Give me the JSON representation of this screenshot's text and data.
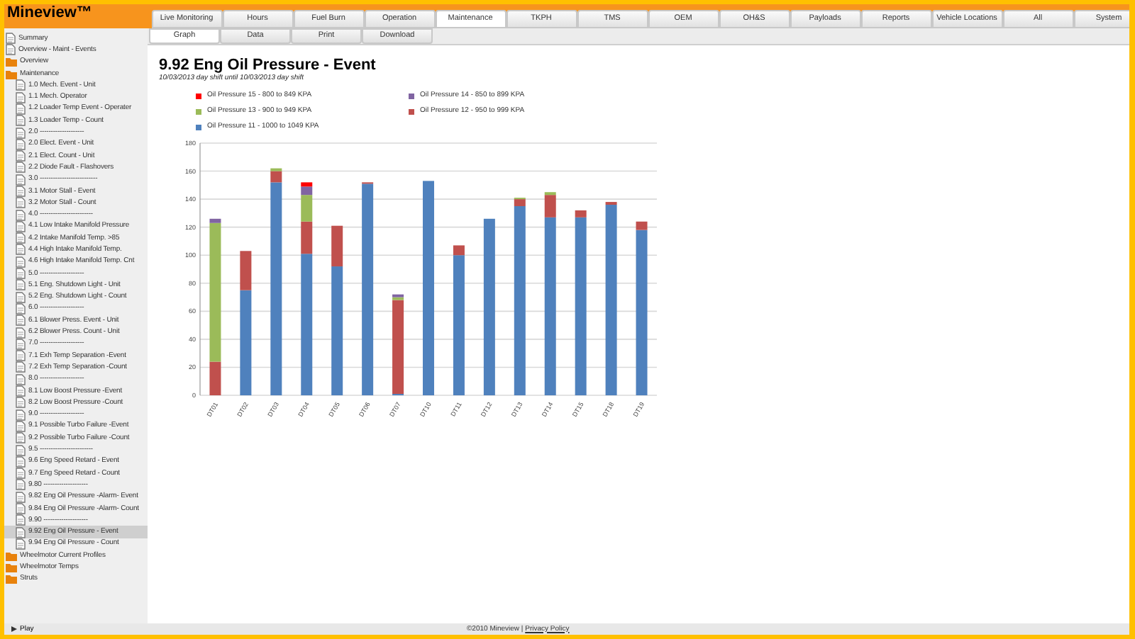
{
  "app": {
    "title": "Mineview™"
  },
  "tabs": [
    {
      "label": "Live Monitoring",
      "selected": false
    },
    {
      "label": "Hours",
      "selected": false
    },
    {
      "label": "Fuel Burn",
      "selected": false
    },
    {
      "label": "Operation",
      "selected": false
    },
    {
      "label": "Maintenance",
      "selected": true
    },
    {
      "label": "TKPH",
      "selected": false
    },
    {
      "label": "TMS",
      "selected": false
    },
    {
      "label": "OEM",
      "selected": false
    },
    {
      "label": "OH&S",
      "selected": false
    },
    {
      "label": "Payloads",
      "selected": false
    },
    {
      "label": "Reports",
      "selected": false
    },
    {
      "label": "Vehicle Locations",
      "selected": false
    },
    {
      "label": "All",
      "selected": false
    },
    {
      "label": "System",
      "selected": false
    }
  ],
  "subtabs": [
    {
      "label": "Graph",
      "selected": true
    },
    {
      "label": "Data",
      "selected": false
    },
    {
      "label": "Print",
      "selected": false
    },
    {
      "label": "Download",
      "selected": false
    }
  ],
  "sidebar": {
    "items": [
      {
        "label": "Summary",
        "kind": "doc",
        "selected": false
      },
      {
        "label": "Overview - Maint - Events",
        "kind": "doc",
        "selected": false
      },
      {
        "label": "Overview",
        "kind": "folder",
        "selected": false
      },
      {
        "label": "Maintenance",
        "kind": "folder",
        "selected": false,
        "children": [
          {
            "label": "1.0 Mech. Event - Unit",
            "kind": "doc",
            "selected": false
          },
          {
            "label": "1.1 Mech. Operator",
            "kind": "doc",
            "selected": false
          },
          {
            "label": "1.2 Loader Temp Event - Operater",
            "kind": "doc",
            "selected": false
          },
          {
            "label": "1.3 Loader Temp - Count",
            "kind": "doc",
            "selected": false
          },
          {
            "label": "2.0 --------------------",
            "kind": "doc",
            "selected": false
          },
          {
            "label": "2.0 Elect. Event - Unit",
            "kind": "doc",
            "selected": false
          },
          {
            "label": "2.1 Elect. Count - Unit",
            "kind": "doc",
            "selected": false
          },
          {
            "label": "2.2 Diode Fault - Flashovers",
            "kind": "doc",
            "selected": false
          },
          {
            "label": "3.0 --------------------------",
            "kind": "doc",
            "selected": false
          },
          {
            "label": "3.1 Motor Stall - Event",
            "kind": "doc",
            "selected": false
          },
          {
            "label": "3.2 Motor Stall - Count",
            "kind": "doc",
            "selected": false
          },
          {
            "label": "4.0 ------------------------",
            "kind": "doc",
            "selected": false
          },
          {
            "label": "4.1 Low Intake Manifold Pressure",
            "kind": "doc",
            "selected": false
          },
          {
            "label": "4.2 Intake Manifold Temp. >85",
            "kind": "doc",
            "selected": false
          },
          {
            "label": "4.4 High Intake Manifold Temp.",
            "kind": "doc",
            "selected": false
          },
          {
            "label": "4.6 High Intake Manifold Temp. Cnt",
            "kind": "doc",
            "selected": false
          },
          {
            "label": "5.0 --------------------",
            "kind": "doc",
            "selected": false
          },
          {
            "label": "5.1 Eng. Shutdown Light - Unit",
            "kind": "doc",
            "selected": false
          },
          {
            "label": "5.2 Eng. Shutdown Light - Count",
            "kind": "doc",
            "selected": false
          },
          {
            "label": "6.0 --------------------",
            "kind": "doc",
            "selected": false
          },
          {
            "label": "6.1 Blower Press. Event - Unit",
            "kind": "doc",
            "selected": false
          },
          {
            "label": "6.2 Blower Press. Count - Unit",
            "kind": "doc",
            "selected": false
          },
          {
            "label": "7.0 --------------------",
            "kind": "doc",
            "selected": false
          },
          {
            "label": "7.1 Exh Temp Separation -Event",
            "kind": "doc",
            "selected": false
          },
          {
            "label": "7.2 Exh Temp Separation -Count",
            "kind": "doc",
            "selected": false
          },
          {
            "label": "8.0 --------------------",
            "kind": "doc",
            "selected": false
          },
          {
            "label": "8.1 Low Boost Pressure -Event",
            "kind": "doc",
            "selected": false
          },
          {
            "label": "8.2 Low Boost Pressure -Count",
            "kind": "doc",
            "selected": false
          },
          {
            "label": "9.0 --------------------",
            "kind": "doc",
            "selected": false
          },
          {
            "label": "9.1 Possible Turbo Failure -Event",
            "kind": "doc",
            "selected": false
          },
          {
            "label": "9.2 Possible Turbo Failure -Count",
            "kind": "doc",
            "selected": false
          },
          {
            "label": "9.5 ------------------------",
            "kind": "doc",
            "selected": false
          },
          {
            "label": "9.6 Eng Speed Retard - Event",
            "kind": "doc",
            "selected": false
          },
          {
            "label": "9.7 Eng Speed Retard - Count",
            "kind": "doc",
            "selected": false
          },
          {
            "label": "9.80 --------------------",
            "kind": "doc",
            "selected": false
          },
          {
            "label": "9.82 Eng Oil Pressure -Alarm- Event",
            "kind": "doc",
            "selected": false
          },
          {
            "label": "9.84 Eng Oil Pressure -Alarm- Count",
            "kind": "doc",
            "selected": false
          },
          {
            "label": "9.90 --------------------",
            "kind": "doc",
            "selected": false
          },
          {
            "label": "9.92 Eng Oil Pressure - Event",
            "kind": "doc",
            "selected": true
          },
          {
            "label": "9.94 Eng Oil Pressure - Count",
            "kind": "doc",
            "selected": false
          }
        ]
      },
      {
        "label": "Wheelmotor Current Profiles",
        "kind": "folder",
        "selected": false
      },
      {
        "label": "Wheelmotor Temps",
        "kind": "folder",
        "selected": false
      },
      {
        "label": "Struts",
        "kind": "folder",
        "selected": false
      }
    ]
  },
  "report": {
    "title": "9.92 Eng Oil Pressure - Event",
    "subtitle": "10/03/2013 day shift until 10/03/2013 day shift",
    "chart_data": {
      "type": "bar",
      "stacked": true,
      "grid": true,
      "categories": [
        "DT01",
        "DT02",
        "DT03",
        "DT04",
        "DT05",
        "DT06",
        "DT07",
        "DT10",
        "DT11",
        "DT12",
        "DT13",
        "DT14",
        "DT15",
        "DT18",
        "DT19"
      ],
      "ylim": [
        0,
        180
      ],
      "yticks": [
        0,
        20,
        40,
        60,
        80,
        100,
        120,
        140,
        160,
        180
      ],
      "series": [
        {
          "name": "Oil Pressure 11 - 1000 to 1049 KPA",
          "color": "#4f81bd",
          "values": [
            0,
            75,
            152,
            101,
            92,
            151,
            1,
            153,
            100,
            126,
            135,
            127,
            127,
            136,
            118
          ]
        },
        {
          "name": "Oil Pressure 12 - 950 to 999 KPA",
          "color": "#c0504d",
          "values": [
            24,
            28,
            8,
            23,
            29,
            1,
            67,
            0,
            7,
            0,
            5,
            16,
            5,
            2,
            6
          ]
        },
        {
          "name": "Oil Pressure 13 - 900 to 949 KPA",
          "color": "#9bbb59",
          "values": [
            99,
            0,
            2,
            19,
            0,
            0,
            2,
            0,
            0,
            0,
            1,
            2,
            0,
            0,
            0
          ]
        },
        {
          "name": "Oil Pressure 14 - 850 to 899 KPA",
          "color": "#8064a2",
          "values": [
            3,
            0,
            0,
            6,
            0,
            0,
            2,
            0,
            0,
            0,
            0,
            0,
            0,
            0,
            0
          ]
        },
        {
          "name": "Oil Pressure 15 - 800 to 849 KPA",
          "color": "#ff0000",
          "values": [
            0,
            0,
            0,
            3,
            0,
            0,
            0,
            0,
            0,
            0,
            0,
            0,
            0,
            0,
            0
          ]
        }
      ]
    }
  },
  "footer": {
    "play": "Play",
    "copyright": "©2010 Mineview | ",
    "privacy_link": "Privacy Policy"
  }
}
